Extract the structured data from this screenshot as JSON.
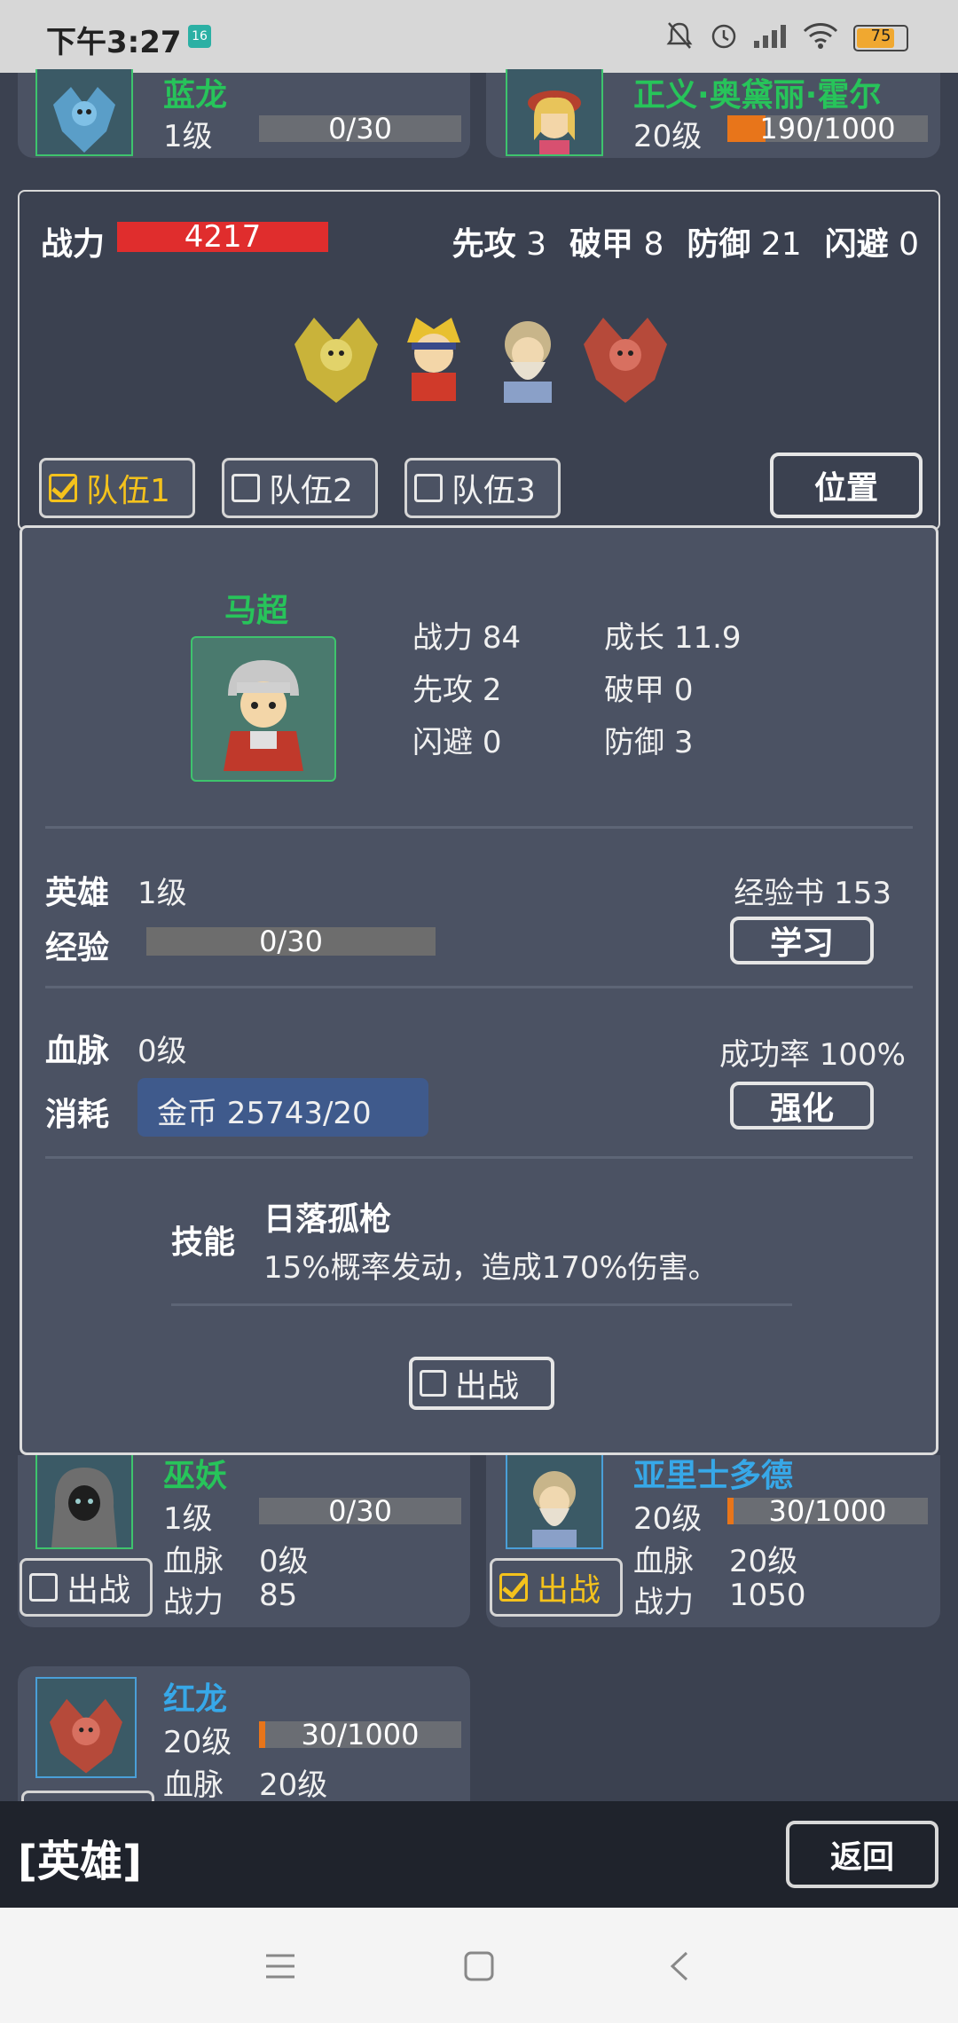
{
  "status": {
    "time": "下午3:27",
    "notif_badge": "16",
    "battery": "75"
  },
  "top_heroes": [
    {
      "name": "蓝龙",
      "level": "1级",
      "exp": "0/30",
      "progress": 0.0
    },
    {
      "name": "正义·奥黛丽·霍尔",
      "level": "20级",
      "exp": "190/1000",
      "progress": 0.19
    }
  ],
  "team": {
    "power_label": "战力",
    "power_value": "4217",
    "stats": [
      {
        "label": "先攻",
        "value": "3"
      },
      {
        "label": "破甲",
        "value": "8"
      },
      {
        "label": "防御",
        "value": "21"
      },
      {
        "label": "闪避",
        "value": "0"
      }
    ],
    "teams": [
      {
        "label": "队伍1",
        "checked": true
      },
      {
        "label": "队伍2",
        "checked": false
      },
      {
        "label": "队伍3",
        "checked": false
      }
    ],
    "position_button": "位置"
  },
  "detail": {
    "name": "马超",
    "stats": [
      {
        "label": "战力",
        "value": "84"
      },
      {
        "label": "成长",
        "value": "11.9"
      },
      {
        "label": "先攻",
        "value": "2"
      },
      {
        "label": "破甲",
        "value": "0"
      },
      {
        "label": "闪避",
        "value": "0"
      },
      {
        "label": "防御",
        "value": "3"
      }
    ],
    "hero_label": "英雄",
    "hero_level": "1级",
    "exp_book": "经验书 153",
    "exp_label": "经验",
    "exp_value": "0/30",
    "exp_progress": 0.0,
    "learn_button": "学习",
    "blood_label": "血脉",
    "blood_level": "0级",
    "success_rate": "成功率 100%",
    "cost_label": "消耗",
    "cost_value": "金币 25743/20",
    "enhance_button": "强化",
    "skill_label": "技能",
    "skill_name": "日落孤枪",
    "skill_desc": "15%概率发动，造成170%伤害。",
    "deploy_button": "出战"
  },
  "lower_heroes": [
    {
      "name": "巫妖",
      "level": "1级",
      "exp": "0/30",
      "progress": 0.0,
      "blood": "血脉",
      "blood_level": "0级",
      "power": "战力",
      "power_value": "85",
      "deploy": "出战",
      "deployed": false
    },
    {
      "name": "亚里士多德",
      "level": "20级",
      "exp": "30/1000",
      "progress": 0.03,
      "blood": "血脉",
      "blood_level": "20级",
      "power": "战力",
      "power_value": "1050",
      "deploy": "出战",
      "deployed": true
    },
    {
      "name": "红龙",
      "level": "20级",
      "exp": "30/1000",
      "progress": 0.03,
      "blood": "血脉",
      "blood_level": "20级"
    }
  ],
  "footer": {
    "title": "[英雄]",
    "back_button": "返回"
  },
  "colors": {
    "power_bar": "#e02d2d",
    "name_green": "#27c45a",
    "name_blue": "#37a8e8",
    "check_yellow": "#f4c21c",
    "exp_orange": "#e8751a"
  }
}
